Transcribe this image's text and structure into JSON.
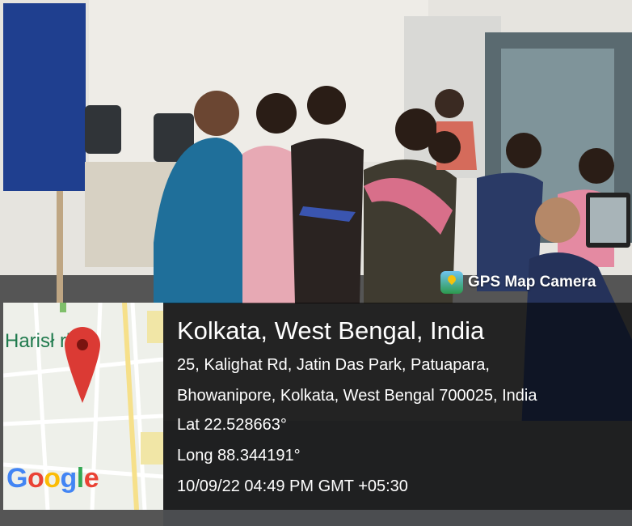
{
  "badge": {
    "label": "GPS Map Camera",
    "icon": "gps-map-camera-app-icon"
  },
  "map": {
    "street_label": "Harisł   rk",
    "brand": [
      "G",
      "o",
      "o",
      "g",
      "l",
      "e"
    ],
    "brand_colors": [
      "#4285F4",
      "#EA4335",
      "#FBBC05",
      "#4285F4",
      "#34A853",
      "#EA4335"
    ],
    "pin_color": "#DB3A34"
  },
  "location": {
    "title": "Kolkata, West Bengal, India",
    "address_line1": "25, Kalighat Rd, Jatin Das Park, Patuapara,",
    "address_line2": "Bhowanipore, Kolkata, West Bengal 700025, India",
    "lat": "Lat 22.528663°",
    "long": "Long 88.344191°",
    "datetime": "10/09/22 04:49 PM GMT +05:30"
  }
}
